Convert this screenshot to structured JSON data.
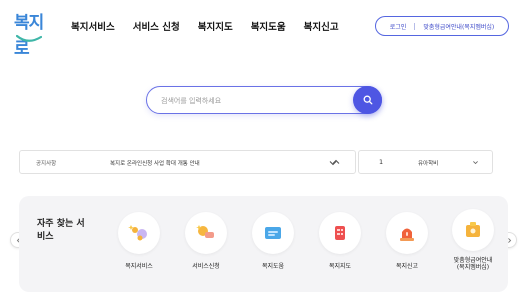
{
  "header": {
    "logo_text": "복지로",
    "nav": [
      "복지서비스",
      "서비스 신청",
      "복지지도",
      "복지도움",
      "복지신고"
    ],
    "util": {
      "login": "로그인",
      "mypage": "맞춤형급여안내(복지멤버십)"
    }
  },
  "search": {
    "placeholder": "검색어를 입력하세요"
  },
  "notice": {
    "label": "공지사항",
    "text": "복지로 온라인신청 사업 확대 개통 안내"
  },
  "page_select": {
    "number": "1",
    "name": "유아학비"
  },
  "frequent": {
    "title": "자주 찾는 서비스",
    "items": [
      {
        "label": "복지서비스",
        "icon": "welfare-service-icon"
      },
      {
        "label": "서비스신청",
        "icon": "service-apply-icon"
      },
      {
        "label": "복지도움",
        "icon": "welfare-help-icon"
      },
      {
        "label": "복지지도",
        "icon": "welfare-map-icon"
      },
      {
        "label": "복지신고",
        "icon": "welfare-report-icon"
      },
      {
        "label": "맞춤형급여안내\n(복지멤버십)",
        "icon": "custom-benefit-icon"
      }
    ]
  },
  "colors": {
    "brand": "#4e56e3",
    "logo": "#3a86d8",
    "panel": "#f4f4f6"
  }
}
